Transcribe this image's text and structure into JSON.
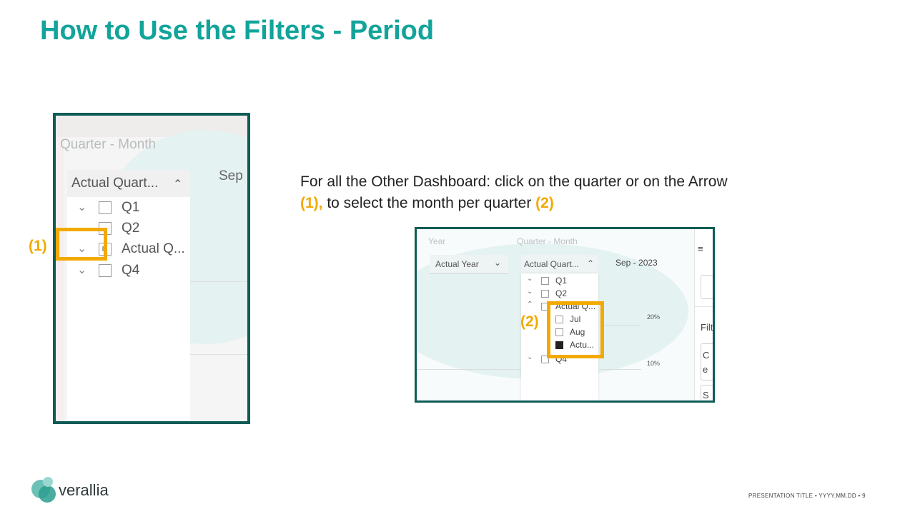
{
  "title": "How to Use the Filters - Period",
  "left_screenshot": {
    "header": "Quarter - Month",
    "dropdown_label": "Actual Quart...",
    "dropdown_chevron": "^",
    "right_label": "Sep",
    "items": [
      {
        "chevron": "v",
        "label": "Q1"
      },
      {
        "chevron": "v",
        "label": "Q2"
      },
      {
        "chevron": "v",
        "label": "Actual Q..."
      },
      {
        "chevron": "v",
        "label": "Q4"
      }
    ],
    "callout": "(1)"
  },
  "instruction": {
    "line1": "For all the Other Dashboard: click on the quarter or on the Arrow",
    "marker1": "(1),",
    "line2_mid": " to select the month per quarter ",
    "marker2": "(2)"
  },
  "right_screenshot": {
    "year_header": "Year",
    "qm_header": "Quarter - Month",
    "year_dropdown": "Actual Year",
    "quarter_dropdown": "Actual Quart...",
    "date_label": "Sep - 2023",
    "axis_20": "20%",
    "axis_10": "10%",
    "filter_text": "Filt",
    "quarters": [
      {
        "chevron": "v",
        "label": "Q1"
      },
      {
        "chevron": "v",
        "label": "Q2"
      },
      {
        "chevron": "^",
        "label": "Actual Q..."
      },
      {
        "chevron": "v",
        "label": "Q4"
      }
    ],
    "months": [
      {
        "label": "Jul",
        "selected": false
      },
      {
        "label": "Aug",
        "selected": false
      },
      {
        "label": "Actu...",
        "selected": true
      }
    ],
    "sidebar_letters": [
      "C",
      "e",
      "S"
    ],
    "callout": "(2)"
  },
  "footer": {
    "logo_text": "verallia",
    "meta": "PRESENTATION TITLE  •  YYYY.MM.DD  •   9"
  },
  "colors": {
    "title": "#12a49b",
    "frame_border": "#0e5c55",
    "highlight": "#f2a900"
  }
}
